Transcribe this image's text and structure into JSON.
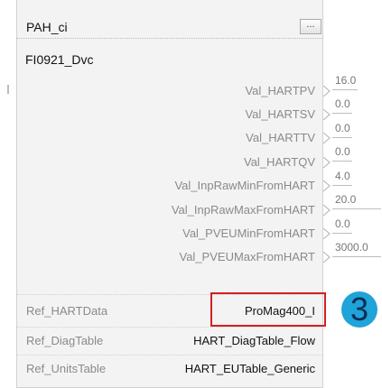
{
  "block": {
    "title": "PAH_ci",
    "menu_button_label": "...",
    "tag_name": "FI0921_Dvc"
  },
  "outputs": [
    {
      "label": "Val_HARTPV",
      "value": "16.0"
    },
    {
      "label": "Val_HARTSV",
      "value": "0.0"
    },
    {
      "label": "Val_HARTTV",
      "value": "0.0"
    },
    {
      "label": "Val_HARTQV",
      "value": "0.0"
    },
    {
      "label": "Val_InpRawMinFromHART",
      "value": "4.0"
    },
    {
      "label": "Val_InpRawMaxFromHART",
      "value": "20.0"
    },
    {
      "label": "Val_PVEUMinFromHART",
      "value": "0.0"
    },
    {
      "label": "Val_PVEUMaxFromHART",
      "value": "3000.0"
    }
  ],
  "refs": [
    {
      "label": "Ref_HARTData",
      "value": "ProMag400_I"
    },
    {
      "label": "Ref_DiagTable",
      "value": "HART_DiagTable_Flow"
    },
    {
      "label": "Ref_UnitsTable",
      "value": "HART_EUTable_Generic"
    }
  ],
  "annotation": {
    "step_number": "3",
    "highlight_color": "#d32020",
    "badge_color": "#1fa3d8"
  }
}
